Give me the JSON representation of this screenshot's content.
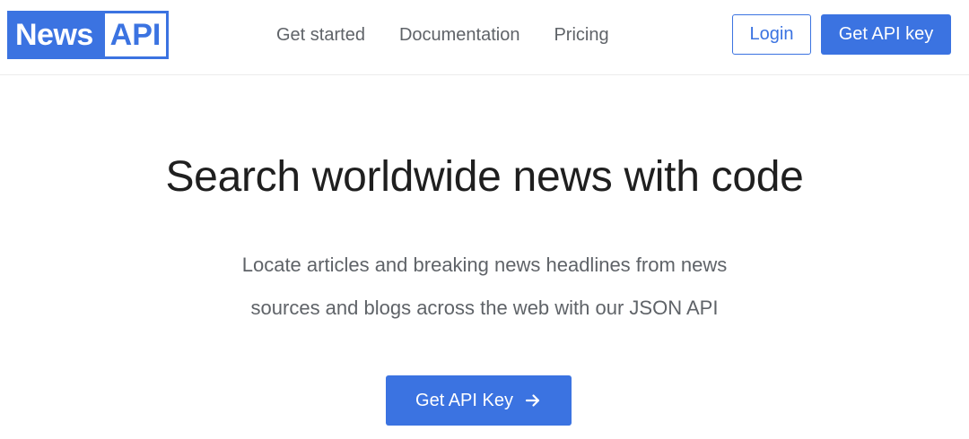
{
  "header": {
    "logo": {
      "part1": "News",
      "part2": "API"
    },
    "nav": [
      {
        "label": "Get started"
      },
      {
        "label": "Documentation"
      },
      {
        "label": "Pricing"
      }
    ],
    "login_label": "Login",
    "api_key_label": "Get API key"
  },
  "hero": {
    "title": "Search worldwide news with code",
    "subtitle_line1": "Locate articles and breaking news headlines from news",
    "subtitle_line2": "sources and blogs across the web with our JSON API",
    "cta_label": "Get API Key",
    "cta_icon": "arrow-right-icon"
  },
  "colors": {
    "brand": "#3b73e1",
    "title": "#1f1f1f",
    "muted": "#5f6368"
  }
}
